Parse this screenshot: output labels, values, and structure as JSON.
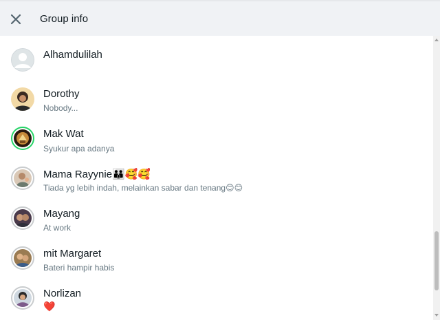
{
  "header": {
    "title": "Group info",
    "close_icon": "close-icon"
  },
  "members": [
    {
      "name": "Alhamdulilah",
      "about": "",
      "avatar": "default-avatar"
    },
    {
      "name": "Dorothy",
      "about": "Nobody...",
      "avatar": "photo"
    },
    {
      "name": "Mak Wat",
      "about": "Syukur apa adanya",
      "avatar": "photo-with-status-ring"
    },
    {
      "name": "Mama Rayynie👪🥰🥰",
      "about": "Tiada yg lebih indah, melainkan sabar dan tenang😊😊",
      "avatar": "photo"
    },
    {
      "name": "Mayang",
      "about": "At work",
      "avatar": "photo"
    },
    {
      "name": "mit Margaret",
      "about": "Bateri hampir habis",
      "avatar": "photo"
    },
    {
      "name": "Norlizan",
      "about": "❤️",
      "avatar": "photo"
    }
  ],
  "colors": {
    "header_bg": "#f0f2f5",
    "name_text": "#111b21",
    "about_text": "#667781",
    "status_ring": "#25d366"
  }
}
